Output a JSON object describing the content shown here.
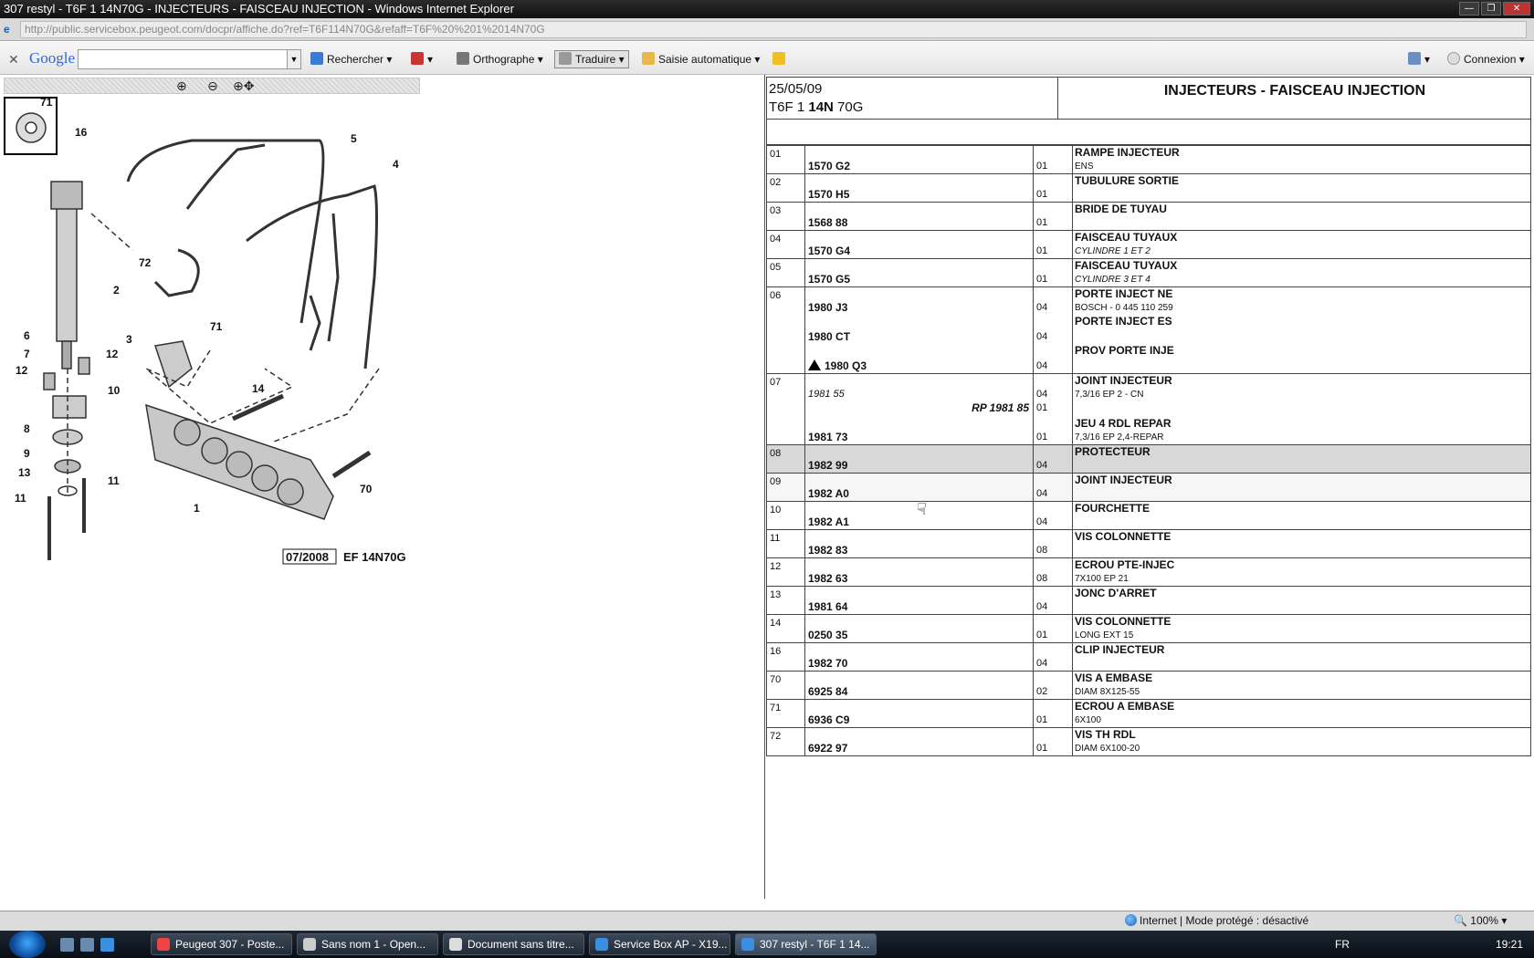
{
  "window": {
    "title": "307 restyl - T6F 1 14N70G - INJECTEURS - FAISCEAU INJECTION - Windows Internet Explorer"
  },
  "address": {
    "url": "http://public.servicebox.peugeot.com/docpr/affiche.do?ref=T6F114N70G&refaff=T6F%20%201%2014N70G"
  },
  "google_toolbar": {
    "logo": "Google",
    "search_value": "",
    "rechercher": "Rechercher",
    "orthographe": "Orthographe",
    "traduire": "Traduire",
    "saisie": "Saisie automatique",
    "connexion": "Connexion"
  },
  "diagram": {
    "zoom_in_icon": "zoom-in-icon",
    "zoom_out_icon": "zoom-out-icon",
    "pan_icon": "pan-zoom-icon",
    "date_stamp": "07/2008",
    "ref_stamp": "EF 14N70G",
    "callouts": [
      "71",
      "16",
      "5",
      "4",
      "72",
      "2",
      "71",
      "3",
      "14",
      "6",
      "7",
      "12",
      "12",
      "10",
      "8",
      "9",
      "13",
      "11",
      "11",
      "1",
      "70"
    ]
  },
  "header": {
    "date": "25/05/09",
    "model_prefix": "T6F 1 ",
    "model_bold": "14N",
    "model_suffix": " 70G",
    "title": "INJECTEURS - FAISCEAU INJECTION"
  },
  "parts": [
    {
      "num": "01",
      "ref": "1570 G2",
      "qty": "01",
      "desc": "RAMPE INJECTEUR",
      "sub": "ENS"
    },
    {
      "num": "02",
      "ref": "1570 H5",
      "qty": "01",
      "desc": "TUBULURE SORTIE",
      "sub": ""
    },
    {
      "num": "03",
      "ref": "1568 88",
      "qty": "01",
      "desc": "BRIDE DE TUYAU",
      "sub": ""
    },
    {
      "num": "04",
      "ref": "1570 G4",
      "qty": "01",
      "desc": "FAISCEAU TUYAUX",
      "sub": "CYLINDRE 1 ET 2"
    },
    {
      "num": "05",
      "ref": "1570 G5",
      "qty": "01",
      "desc": "FAISCEAU TUYAUX",
      "sub": "CYLINDRE 3 ET 4"
    },
    {
      "num": "06",
      "ref": "1980 J3",
      "qty": "04",
      "desc": "PORTE INJECT NE",
      "sub": "BOSCH - 0 445 110 259",
      "ref2": "1980 CT",
      "qty2": "04",
      "desc2": "PORTE INJECT ES",
      "ref3": "1980 Q3",
      "qty3": "04",
      "desc3": "PROV PORTE INJE"
    },
    {
      "num": "07",
      "ref": "1981 55",
      "qty": "04",
      "desc": "JOINT INJECTEUR",
      "sub": "7,3/16 EP 2 - CN",
      "rp": "RP 1981 85",
      "rp_qty": "01",
      "ref3": "1981 73",
      "qty3": "01",
      "desc3": "JEU 4 RDL REPAR",
      "sub3": "7,3/16 EP 2,4-REPAR"
    },
    {
      "num": "08",
      "ref": "1982 99",
      "qty": "04",
      "desc": "PROTECTEUR",
      "sub": ""
    },
    {
      "num": "09",
      "ref": "1982 A0",
      "qty": "04",
      "desc": "JOINT INJECTEUR",
      "sub": ""
    },
    {
      "num": "10",
      "ref": "1982 A1",
      "qty": "04",
      "desc": "FOURCHETTE",
      "sub": ""
    },
    {
      "num": "11",
      "ref": "1982 83",
      "qty": "08",
      "desc": "VIS COLONNETTE",
      "sub": ""
    },
    {
      "num": "12",
      "ref": "1982 63",
      "qty": "08",
      "desc": "ECROU PTE-INJEC",
      "sub": "7X100 EP 21"
    },
    {
      "num": "13",
      "ref": "1981 64",
      "qty": "04",
      "desc": "JONC D'ARRET",
      "sub": ""
    },
    {
      "num": "14",
      "ref": "0250 35",
      "qty": "01",
      "desc": "VIS COLONNETTE",
      "sub": "LONG EXT 15"
    },
    {
      "num": "16",
      "ref": "1982 70",
      "qty": "04",
      "desc": "CLIP INJECTEUR",
      "sub": ""
    },
    {
      "num": "70",
      "ref": "6925 84",
      "qty": "02",
      "desc": "VIS A EMBASE",
      "sub": "DIAM 8X125-55"
    },
    {
      "num": "71",
      "ref": "6936 C9",
      "qty": "01",
      "desc": "ECROU A EMBASE",
      "sub": "6X100"
    },
    {
      "num": "72",
      "ref": "6922 97",
      "qty": "01",
      "desc": "VIS TH RDL",
      "sub": "DIAM 6X100-20"
    }
  ],
  "statusbar": {
    "zone": "Internet | Mode protégé : désactivé",
    "zoom": "100%"
  },
  "taskbar": {
    "tasks": [
      "Peugeot 307 - Poste...",
      "Sans nom 1 - Open...",
      "Document sans titre...",
      "Service Box AP - X19...",
      "307 restyl - T6F 1 14..."
    ],
    "lang": "FR",
    "time": "19:21"
  }
}
